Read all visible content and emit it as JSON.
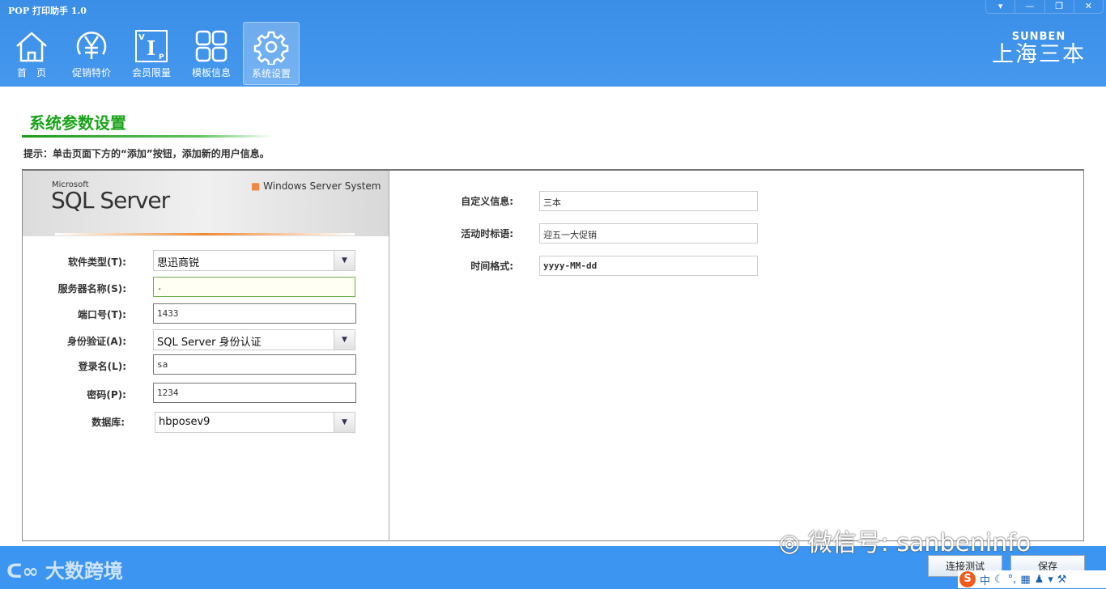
{
  "window": {
    "title": "POP 打印助手 1.0",
    "controls": [
      "▾",
      "—",
      "❐",
      "✕"
    ]
  },
  "nav": [
    {
      "label": "首　页",
      "icon": "home-icon"
    },
    {
      "label": "促销特价",
      "icon": "yen-icon"
    },
    {
      "label": "会员限量",
      "icon": "vip-icon"
    },
    {
      "label": "模板信息",
      "icon": "grid-icon"
    },
    {
      "label": "系统设置",
      "icon": "gear-icon",
      "active": true
    }
  ],
  "brand": {
    "en": "SUNBEN",
    "cn": "上海三本"
  },
  "page": {
    "title": "系统参数设置",
    "hint": "提示：单击页面下方的“添加”按钮，添加新的用户信息。"
  },
  "banner": {
    "microsoft": "Microsoft",
    "product": "SQL Server",
    "wss": "Windows Server System"
  },
  "db_form": {
    "software_type": {
      "label": "软件类型(T):",
      "value": "思迅商锐"
    },
    "server_name": {
      "label": "服务器名称(S):",
      "value": "."
    },
    "port": {
      "label": "端口号(T):",
      "value": "1433"
    },
    "auth": {
      "label": "身份验证(A):",
      "value": "SQL Server 身份认证"
    },
    "login": {
      "label": "登录名(L):",
      "value": "sa"
    },
    "password": {
      "label": "密码(P):",
      "value": "1234"
    },
    "database": {
      "label": "数据库:",
      "value": "hbposev9"
    }
  },
  "custom_form": {
    "custom_info": {
      "label": "自定义信息:",
      "value": "三本"
    },
    "slogan": {
      "label": "活动时标语:",
      "value": "迎五一大促销"
    },
    "date_format": {
      "label": "时间格式:",
      "value": "yyyy-MM-dd"
    }
  },
  "footer": {
    "logo": "大数跨境",
    "test_button": "连接测试",
    "save_button": "保存",
    "watermark": "微信号: sanbeninfo",
    "ime": "中"
  },
  "colors": {
    "accent": "#3c95f0",
    "title_green": "#1aa31a"
  }
}
